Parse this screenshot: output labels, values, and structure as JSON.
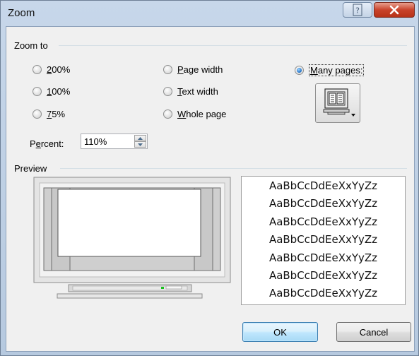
{
  "window": {
    "title": "Zoom"
  },
  "titlebar": {
    "help_label": "?",
    "close_label": "X"
  },
  "zoom_to": {
    "group_label": "Zoom to",
    "options": [
      {
        "label": "200%",
        "checked": false
      },
      {
        "label": "100%",
        "checked": false
      },
      {
        "label": "75%",
        "checked": false
      },
      {
        "label": "Page width",
        "checked": false
      },
      {
        "label": "Text width",
        "checked": false
      },
      {
        "label": "Whole page",
        "checked": false
      },
      {
        "label": "Many pages:",
        "checked": true
      }
    ],
    "percent_label": "Percent:",
    "percent_value": "110%"
  },
  "preview": {
    "group_label": "Preview",
    "sample_lines": [
      "AaBbCcDdEeXxYyZz",
      "AaBbCcDdEeXxYyZz",
      "AaBbCcDdEeXxYyZz",
      "AaBbCcDdEeXxYyZz",
      "AaBbCcDdEeXxYyZz",
      "AaBbCcDdEeXxYyZz",
      "AaBbCcDdEeXxYyZz"
    ]
  },
  "buttons": {
    "ok_label": "OK",
    "cancel_label": "Cancel"
  },
  "icons": {
    "many_pages": "monitor-multiple-pages-icon",
    "help": "question-mark-icon",
    "close": "close-x-icon",
    "spin_up": "triangle-up-icon",
    "spin_down": "triangle-down-icon"
  },
  "colors": {
    "close_button": "#c9432b",
    "ok_button_border": "#3c7fb1",
    "radio_selected": "#1f6fc4"
  }
}
